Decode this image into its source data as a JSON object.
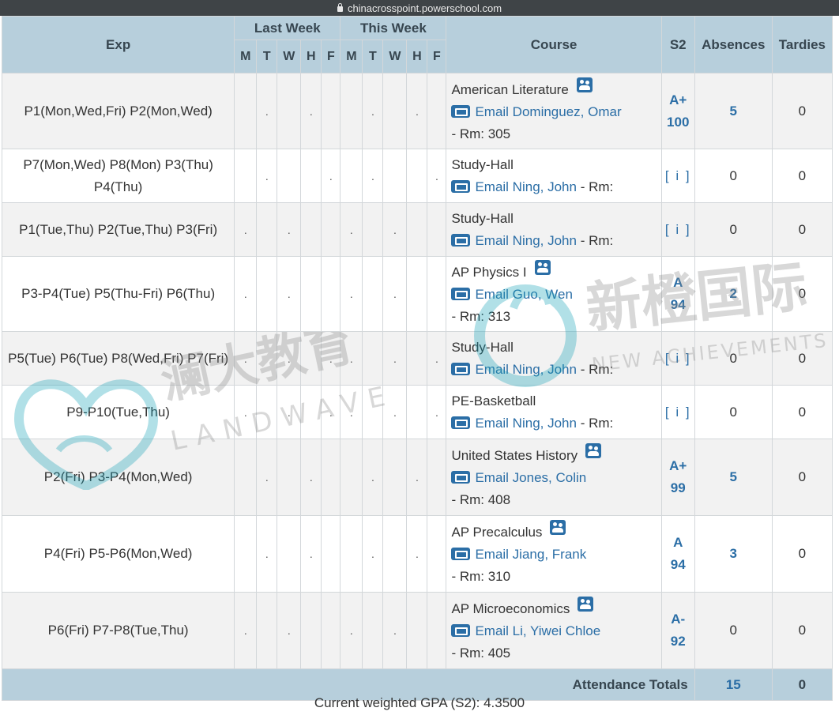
{
  "browser": {
    "url": "chinacrosspoint.powerschool.com"
  },
  "header": {
    "exp": "Exp",
    "last_week": "Last Week",
    "this_week": "This Week",
    "course": "Course",
    "term": "S2",
    "absences": "Absences",
    "tardies": "Tardies",
    "days": [
      "M",
      "T",
      "W",
      "H",
      "F",
      "M",
      "T",
      "W",
      "H",
      "F"
    ]
  },
  "rows": [
    {
      "exp": "P1(Mon,Wed,Fri) P2(Mon,Wed)",
      "days": [
        "",
        ".",
        "",
        ".",
        "",
        "",
        ".",
        "",
        ".",
        ""
      ],
      "course": "American Literature",
      "teacher": "Email Dominguez, Omar",
      "room": "- Rm: 305",
      "grade_letter": "A+",
      "grade_percent": "100",
      "absences": "5",
      "tardies": "0"
    },
    {
      "exp": "P7(Mon,Wed) P8(Mon) P3(Thu) P4(Thu)",
      "days": [
        "",
        ".",
        "",
        "",
        ".",
        "",
        ".",
        "",
        "",
        "."
      ],
      "course": "Study-Hall",
      "teacher": "Email Ning, John",
      "room": "- Rm:",
      "grade_letter": "[ i ]",
      "grade_percent": "",
      "absences": "0",
      "tardies": "0"
    },
    {
      "exp": "P1(Tue,Thu) P2(Tue,Thu) P3(Fri)",
      "days": [
        ".",
        "",
        ".",
        "",
        "",
        ".",
        "",
        ".",
        "",
        ""
      ],
      "course": "Study-Hall",
      "teacher": "Email Ning, John",
      "room": "- Rm:",
      "grade_letter": "[ i ]",
      "grade_percent": "",
      "absences": "0",
      "tardies": "0"
    },
    {
      "exp": "P3-P4(Tue) P5(Thu-Fri) P6(Thu)",
      "days": [
        ".",
        "",
        ".",
        "",
        "",
        ".",
        "",
        ".",
        "",
        ""
      ],
      "course": "AP Physics I",
      "teacher": "Email Guo, Wen",
      "room": "- Rm: 313",
      "grade_letter": "A",
      "grade_percent": "94",
      "absences": "2",
      "tardies": "0"
    },
    {
      "exp": "P5(Tue) P6(Tue) P8(Wed,Fri) P7(Fri)",
      "days": [
        ".",
        "",
        ".",
        "",
        ".",
        ".",
        "",
        ".",
        "",
        "."
      ],
      "course": "Study-Hall",
      "teacher": "Email Ning, John",
      "room": "- Rm:",
      "grade_letter": "[ i ]",
      "grade_percent": "",
      "absences": "0",
      "tardies": "0"
    },
    {
      "exp": "P9-P10(Tue,Thu)",
      "days": [
        ".",
        "",
        ".",
        "",
        ".",
        ".",
        "",
        ".",
        "",
        "."
      ],
      "course": "PE-Basketball",
      "teacher": "Email Ning, John",
      "room": "- Rm:",
      "grade_letter": "[ i ]",
      "grade_percent": "",
      "absences": "0",
      "tardies": "0"
    },
    {
      "exp": "P2(Fri) P3-P4(Mon,Wed)",
      "days": [
        "",
        ".",
        "",
        ".",
        "",
        "",
        ".",
        "",
        ".",
        ""
      ],
      "course": "United States History",
      "teacher": "Email Jones, Colin",
      "room": "- Rm: 408",
      "grade_letter": "A+",
      "grade_percent": "99",
      "absences": "5",
      "tardies": "0"
    },
    {
      "exp": "P4(Fri) P5-P6(Mon,Wed)",
      "days": [
        "",
        ".",
        "",
        ".",
        "",
        "",
        ".",
        "",
        ".",
        ""
      ],
      "course": "AP Precalculus",
      "teacher": "Email Jiang, Frank",
      "room": "- Rm: 310",
      "grade_letter": "A",
      "grade_percent": "94",
      "absences": "3",
      "tardies": "0"
    },
    {
      "exp": "P6(Fri) P7-P8(Tue,Thu)",
      "days": [
        ".",
        "",
        ".",
        "",
        "",
        ".",
        "",
        ".",
        "",
        ""
      ],
      "course": "AP Microeconomics",
      "teacher": "Email Li, Yiwei Chloe",
      "room": "- Rm: 405",
      "grade_letter": "A-",
      "grade_percent": "92",
      "absences": "0",
      "tardies": "0"
    }
  ],
  "totals": {
    "label": "Attendance Totals",
    "absences": "15",
    "tardies": "0"
  },
  "gpa": "Current weighted GPA (S2): 4.3500",
  "watermarks": {
    "left_cn": "澜大教育",
    "left_en": "LANDWAVE",
    "right_cn": "新橙国际",
    "right_en": "NEW ACHIEVEMENTS"
  },
  "colors": {
    "header_bg": "#b7cfdc",
    "link": "#2b6ea6",
    "row_alt": "#f2f2f2"
  }
}
